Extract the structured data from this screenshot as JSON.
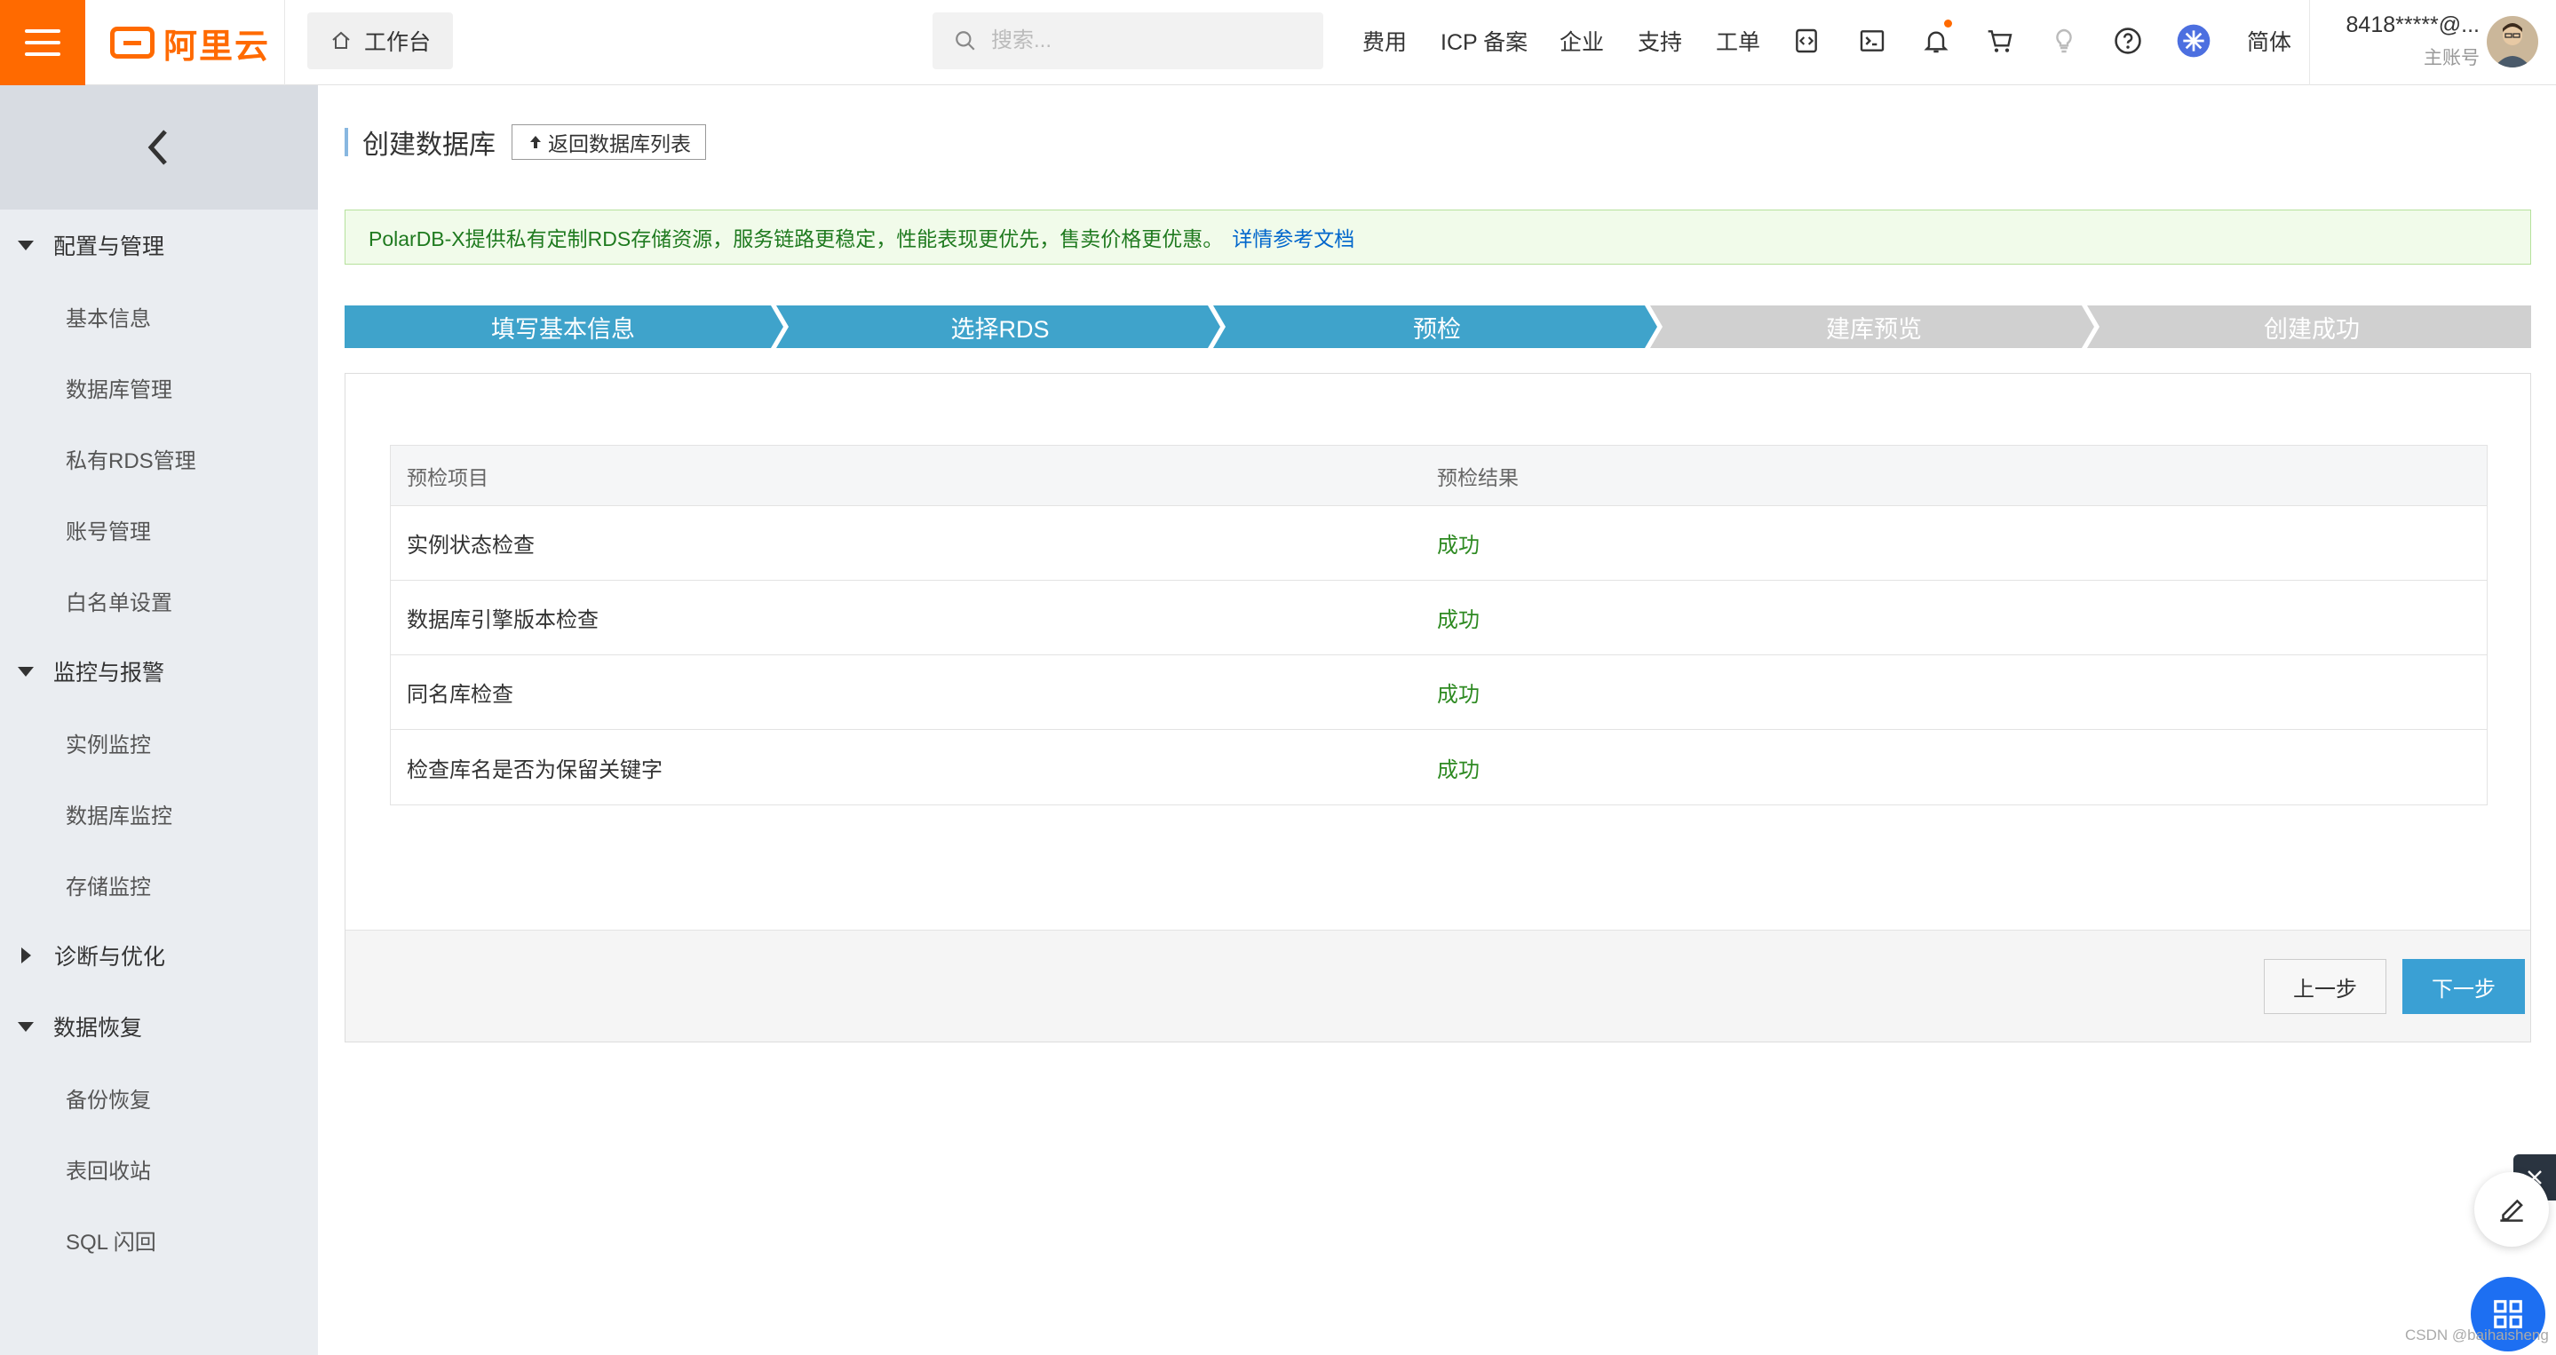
{
  "brand": {
    "name": "阿里云",
    "color": "#ff6a00"
  },
  "header": {
    "workbench": "工作台",
    "search_placeholder": "搜索...",
    "links": [
      "费用",
      "ICP 备案",
      "企业",
      "支持",
      "工单"
    ],
    "icons": [
      "code-icon",
      "terminal-icon",
      "bell-icon",
      "cart-icon",
      "bulb-icon",
      "help-icon",
      "globe-icon"
    ],
    "language": "简体",
    "account_name": "8418*****@...",
    "account_role": "主账号"
  },
  "sidebar": {
    "groups": [
      {
        "label": "配置与管理",
        "expanded": true,
        "items": [
          "基本信息",
          "数据库管理",
          "私有RDS管理",
          "账号管理",
          "白名单设置"
        ]
      },
      {
        "label": "监控与报警",
        "expanded": true,
        "items": [
          "实例监控",
          "数据库监控",
          "存储监控"
        ]
      },
      {
        "label": "诊断与优化",
        "expanded": false,
        "items": []
      },
      {
        "label": "数据恢复",
        "expanded": true,
        "items": [
          "备份恢复",
          "表回收站",
          "SQL 闪回"
        ]
      }
    ]
  },
  "main": {
    "title": "创建数据库",
    "back_button": "返回数据库列表",
    "notice": "PolarDB-X提供私有定制RDS存储资源，服务链路更稳定，性能表现更优先，售卖价格更优惠。",
    "notice_link": "详情参考文档",
    "steps": [
      {
        "label": "填写基本信息",
        "state": "done"
      },
      {
        "label": "选择RDS",
        "state": "done"
      },
      {
        "label": "预检",
        "state": "current"
      },
      {
        "label": "建库预览",
        "state": "pending"
      },
      {
        "label": "创建成功",
        "state": "pending"
      }
    ],
    "table": {
      "headers": [
        "预检项目",
        "预检结果"
      ],
      "rows": [
        [
          "实例状态检查",
          "成功"
        ],
        [
          "数据库引擎版本检查",
          "成功"
        ],
        [
          "同名库检查",
          "成功"
        ],
        [
          "检查库名是否为保留关键字",
          "成功"
        ]
      ]
    },
    "prev_button": "上一步",
    "next_button": "下一步"
  },
  "watermark": "CSDN @baihaisheng",
  "colors": {
    "step_active": "#3fa3cb",
    "step_pending": "#d0d0d0",
    "success": "#2e8a22",
    "primary_button": "#3aa0d4"
  }
}
